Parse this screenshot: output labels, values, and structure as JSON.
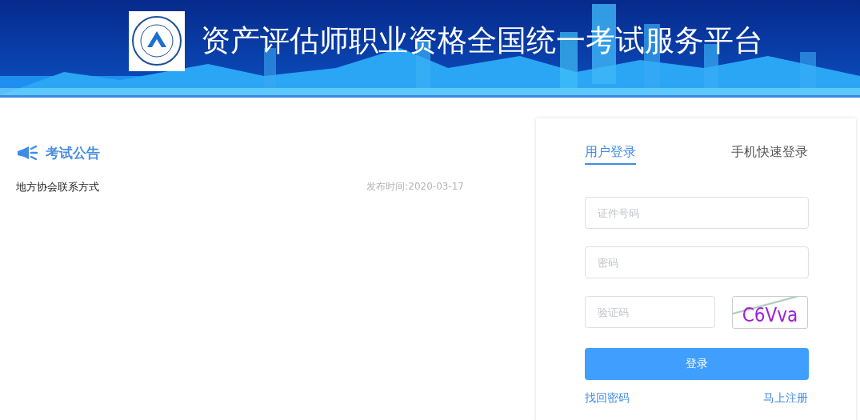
{
  "header": {
    "title": "资产评估师职业资格全国统一考试服务平台"
  },
  "notices": {
    "title": "考试公告",
    "items": [
      {
        "title": "地方协会联系方式",
        "date": "发布时间:2020-03-17"
      }
    ]
  },
  "login": {
    "tabs": [
      {
        "label": "用户登录",
        "selected": true
      },
      {
        "label": "手机快速登录",
        "selected": false
      }
    ],
    "fields": [
      {
        "placeholder": "证件号码"
      },
      {
        "placeholder": "密码"
      }
    ],
    "captcha": {
      "placeholder": "验证码",
      "code": "C6Vva"
    },
    "submit": "登录",
    "links": [
      "找回密码",
      "马上注册"
    ]
  }
}
